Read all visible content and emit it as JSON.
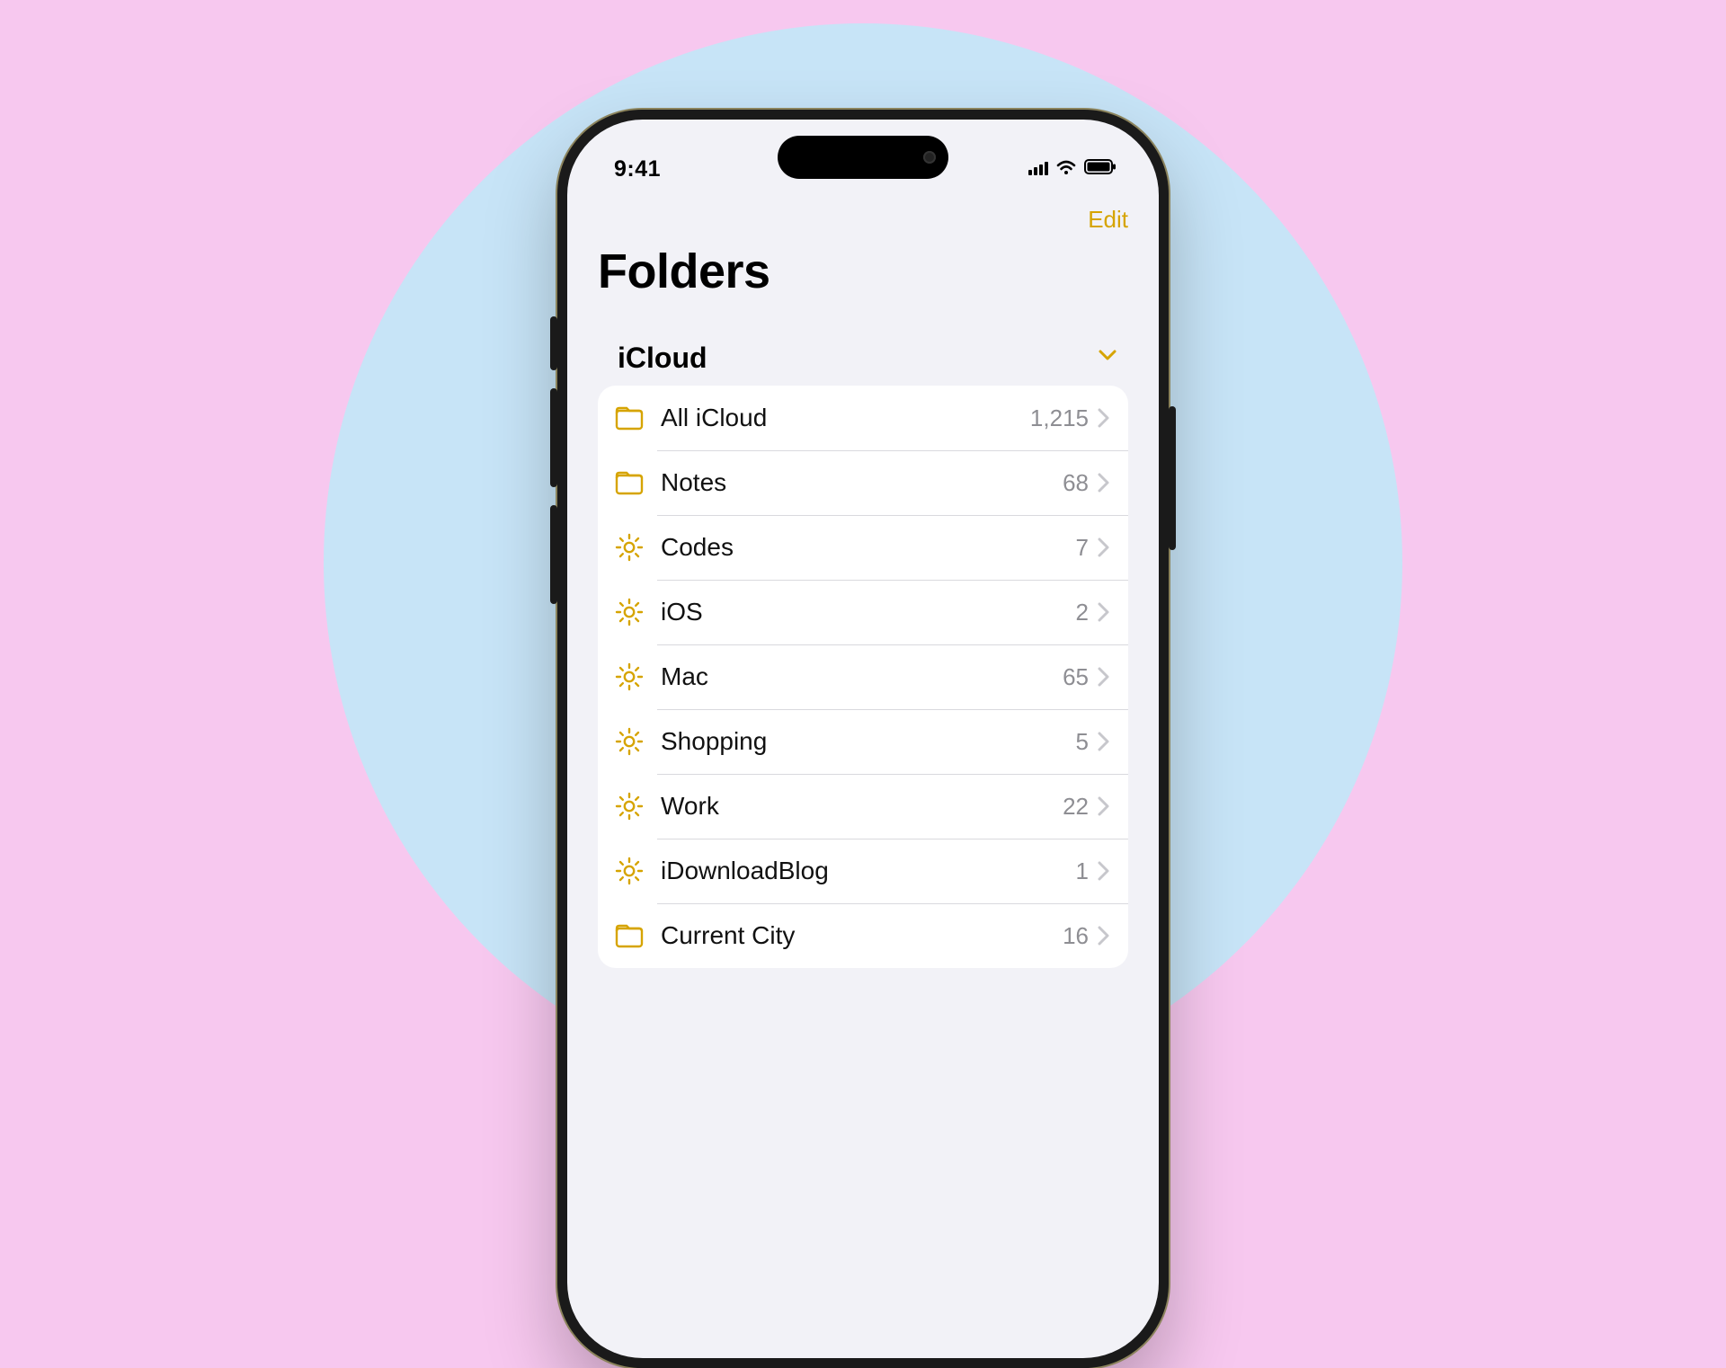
{
  "status_bar": {
    "time": "9:41"
  },
  "navbar": {
    "edit_label": "Edit"
  },
  "page_title": "Folders",
  "section": {
    "title": "iCloud",
    "folders": [
      {
        "icon": "folder",
        "name": "All iCloud",
        "count": "1,215"
      },
      {
        "icon": "folder",
        "name": "Notes",
        "count": "68"
      },
      {
        "icon": "gear",
        "name": "Codes",
        "count": "7"
      },
      {
        "icon": "gear",
        "name": "iOS",
        "count": "2"
      },
      {
        "icon": "gear",
        "name": "Mac",
        "count": "65"
      },
      {
        "icon": "gear",
        "name": "Shopping",
        "count": "5"
      },
      {
        "icon": "gear",
        "name": "Work",
        "count": "22"
      },
      {
        "icon": "gear",
        "name": "iDownloadBlog",
        "count": "1"
      },
      {
        "icon": "folder",
        "name": "Current City",
        "count": "16"
      }
    ]
  },
  "colors": {
    "accent": "#d6a400"
  }
}
